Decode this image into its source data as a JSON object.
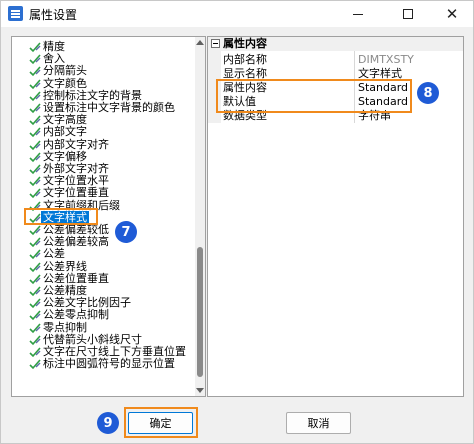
{
  "window": {
    "title": "属性设置",
    "minimize_icon": "minimize-icon",
    "maximize_icon": "maximize-icon",
    "close_icon": "close-icon"
  },
  "tree": {
    "items": [
      {
        "label": "精度"
      },
      {
        "label": "舍入"
      },
      {
        "label": "分隔箭头"
      },
      {
        "label": "文字颜色"
      },
      {
        "label": "控制标注文字的背景"
      },
      {
        "label": "设置标注中文字背景的颜色"
      },
      {
        "label": "文字高度"
      },
      {
        "label": "内部文字"
      },
      {
        "label": "内部文字对齐"
      },
      {
        "label": "文字偏移"
      },
      {
        "label": "外部文字对齐"
      },
      {
        "label": "文字位置水平"
      },
      {
        "label": "文字位置垂直"
      },
      {
        "label": "文字前缀和后缀"
      },
      {
        "label": "文字样式",
        "selected": true
      },
      {
        "label": "公差偏差较低"
      },
      {
        "label": "公差偏差较高"
      },
      {
        "label": "公差"
      },
      {
        "label": "公差界线"
      },
      {
        "label": "公差位置垂直"
      },
      {
        "label": "公差精度"
      },
      {
        "label": "公差文字比例因子"
      },
      {
        "label": "公差零点抑制"
      },
      {
        "label": "零点抑制"
      },
      {
        "label": "代替箭头小斜线尺寸"
      },
      {
        "label": "文字在尺寸线上下方垂直位置"
      },
      {
        "label": "标注中圆弧符号的显示位置"
      }
    ]
  },
  "properties": {
    "group_label": "属性内容",
    "rows": [
      {
        "name": "内部名称",
        "value": "DIMTXSTY",
        "gray": true
      },
      {
        "name": "显示名称",
        "value": "文字样式"
      },
      {
        "name": "属性内容",
        "value": "Standard"
      },
      {
        "name": "默认值",
        "value": "Standard"
      },
      {
        "name": "数据类型",
        "value": "字符串"
      }
    ]
  },
  "callouts": {
    "seven": "7",
    "eight": "8",
    "nine": "9"
  },
  "buttons": {
    "ok": "确定",
    "cancel": "取消"
  },
  "colors": {
    "highlight_box": "#f08a1c",
    "callout_bg": "#1f5bd6",
    "selection_bg": "#0078d7"
  }
}
